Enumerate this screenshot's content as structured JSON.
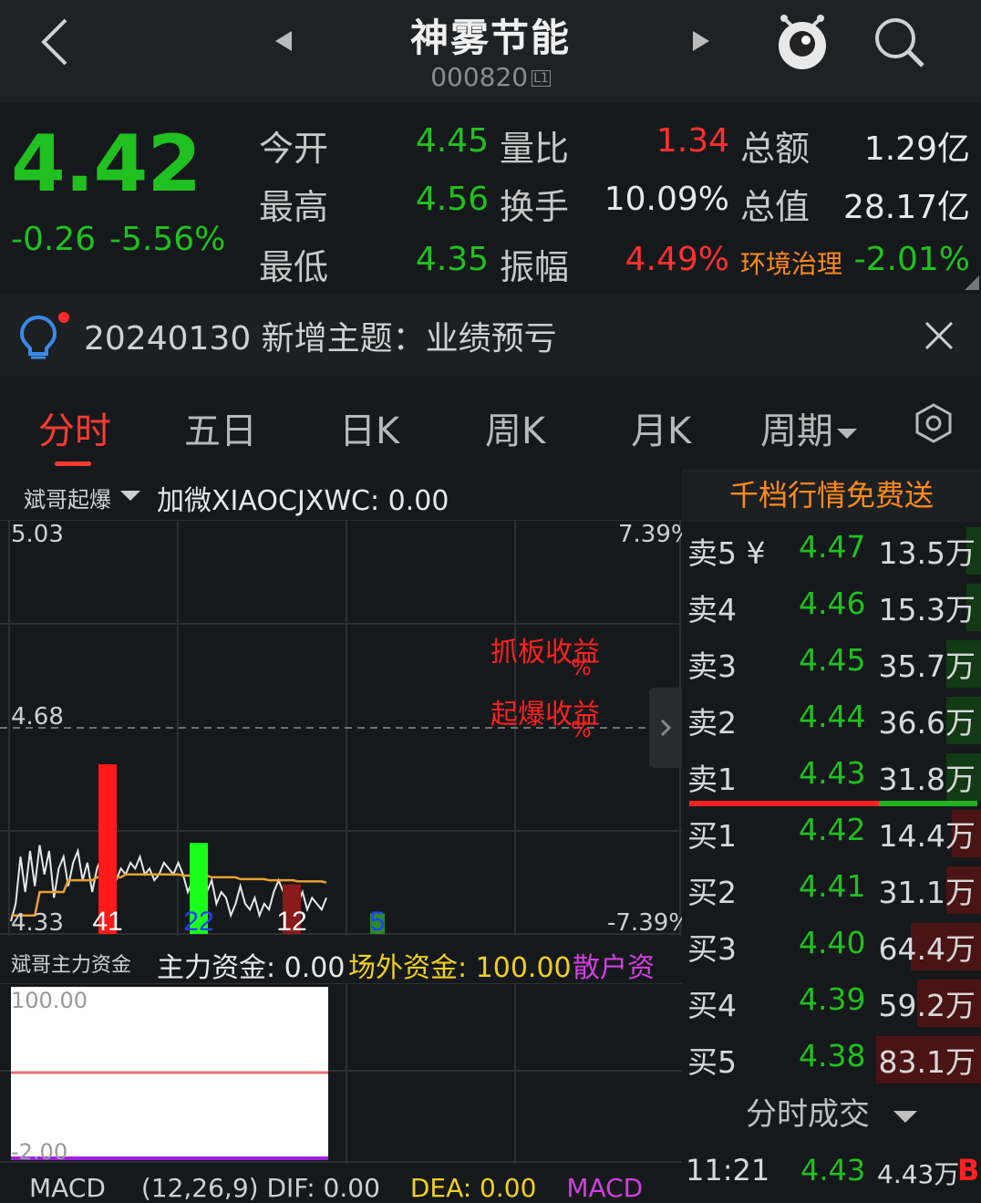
{
  "header": {
    "title": "神雾节能",
    "code": "000820",
    "badge": "L1"
  },
  "quote": {
    "price": "4.42",
    "change": "-0.26",
    "change_pct": "-5.56%",
    "rows": [
      [
        {
          "label": "今开",
          "value": "4.45",
          "color": "g"
        },
        {
          "label": "量比",
          "value": "1.34",
          "color": "r"
        },
        {
          "label": "总额",
          "value": "1.29亿",
          "color": "w"
        }
      ],
      [
        {
          "label": "最高",
          "value": "4.56",
          "color": "g"
        },
        {
          "label": "换手",
          "value": "10.09%",
          "color": "w"
        },
        {
          "label": "总值",
          "value": "28.17亿",
          "color": "w"
        }
      ],
      [
        {
          "label": "最低",
          "value": "4.35",
          "color": "g"
        },
        {
          "label": "振幅",
          "value": "4.49%",
          "color": "r"
        },
        {
          "label": "环境治理",
          "value": "-2.01%",
          "color": "g"
        }
      ]
    ]
  },
  "notice": {
    "text": "20240130 新增主题：业绩预亏"
  },
  "tabs": [
    {
      "label": "分时"
    },
    {
      "label": "五日"
    },
    {
      "label": "日K"
    },
    {
      "label": "周K"
    },
    {
      "label": "月K"
    },
    {
      "label": "周期"
    }
  ],
  "chart": {
    "indicator": "斌哥起爆",
    "indicator_text": "加微XIAOCJXWC: 0.00",
    "y_top": "5.03",
    "y_mid": "4.68",
    "y_bot": "4.33",
    "pct_top": "7.39%",
    "pct_bot": "-7.39%",
    "label1": "抓板收益",
    "label1b": "%",
    "label2": "起爆收益",
    "label2b": "%",
    "bars": [
      {
        "value": 41,
        "label": "41",
        "color": "#ff1a1a"
      },
      {
        "value": 22,
        "label": "22",
        "color": "#1aff1a"
      },
      {
        "value": 12,
        "label": "12",
        "color": "#8b1a1a"
      },
      {
        "value": 5,
        "label": "5",
        "color": "#2a8a2a"
      }
    ]
  },
  "fund": {
    "title": "斌哥主力资金",
    "main": "主力资金: 0.00",
    "outside": "场外资金: 100.00",
    "retail": "散户资",
    "y_top": "100.00",
    "y_bot": "-2.00"
  },
  "macd": {
    "text": "MACD",
    "params": "(12,26,9) DIF: 0.00",
    "dea": "DEA: 0.00",
    "macd": "MACD"
  },
  "book": {
    "header": "千档行情免费送",
    "asks": [
      {
        "label": "卖5 ¥",
        "price": "4.47",
        "vol": "13.5万",
        "bar": 0.05
      },
      {
        "label": "卖4",
        "price": "4.46",
        "vol": "15.3万",
        "bar": 0.05
      },
      {
        "label": "卖3",
        "price": "4.45",
        "vol": "35.7万",
        "bar": 0.12
      },
      {
        "label": "卖2",
        "price": "4.44",
        "vol": "36.6万",
        "bar": 0.12
      },
      {
        "label": "卖1",
        "price": "4.43",
        "vol": "31.8万",
        "bar": 0.12
      }
    ],
    "bids": [
      {
        "label": "买1",
        "price": "4.42",
        "vol": "14.4万",
        "bar": 0.1
      },
      {
        "label": "买2",
        "price": "4.41",
        "vol": "31.1万",
        "bar": 0.12
      },
      {
        "label": "买3",
        "price": "4.40",
        "vol": "64.4万",
        "bar": 0.24
      },
      {
        "label": "买4",
        "price": "4.39",
        "vol": "59.2万",
        "bar": 0.22
      },
      {
        "label": "买5",
        "price": "4.38",
        "vol": "83.1万",
        "bar": 0.36
      }
    ],
    "trades_label": "分时成交",
    "trade": {
      "time": "11:21",
      "price": "4.43",
      "vol": "4.43万",
      "side": "B"
    }
  },
  "colors": {
    "green": "#20c020",
    "red": "#ff3030",
    "orange": "#ff8a1a"
  }
}
